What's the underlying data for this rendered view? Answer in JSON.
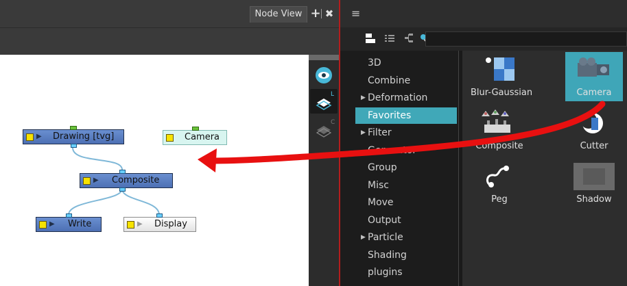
{
  "node_view": {
    "tab_title": "Node View",
    "add_symbol": "+",
    "close_symbol": "✖",
    "nodes": {
      "drawing": "Drawing  [tvg]",
      "camera": "Camera",
      "composite": "Composite",
      "write": "Write",
      "display": "Display"
    }
  },
  "side_strip": {
    "layer_letter": "L",
    "camera_letter": "C"
  },
  "library": {
    "menu_icon": "≡",
    "categories": [
      {
        "label": "3D",
        "expandable": false
      },
      {
        "label": "Combine",
        "expandable": false
      },
      {
        "label": "Deformation",
        "expandable": true
      },
      {
        "label": "Favorites",
        "expandable": false,
        "selected": true
      },
      {
        "label": "Filter",
        "expandable": true
      },
      {
        "label": "Generator",
        "expandable": false
      },
      {
        "label": "Group",
        "expandable": false
      },
      {
        "label": "Misc",
        "expandable": false
      },
      {
        "label": "Move",
        "expandable": false
      },
      {
        "label": "Output",
        "expandable": false
      },
      {
        "label": "Particle",
        "expandable": true
      },
      {
        "label": "Shading",
        "expandable": false
      },
      {
        "label": "plugins",
        "expandable": false
      }
    ],
    "tiles": [
      {
        "label": "Blur-Gaussian",
        "icon": "blur-gaussian-icon"
      },
      {
        "label": "Camera",
        "icon": "camera-icon",
        "selected": true
      },
      {
        "label": "Composite",
        "icon": "composite-icon"
      },
      {
        "label": "Cutter",
        "icon": "cutter-icon"
      },
      {
        "label": "Peg",
        "icon": "peg-icon"
      },
      {
        "label": "Shadow",
        "icon": "shadow-icon"
      }
    ]
  },
  "colors": {
    "selection_accent": "#40a8b8",
    "drag_arrow": "#e81010",
    "panel_divider": "#b41d1d"
  }
}
